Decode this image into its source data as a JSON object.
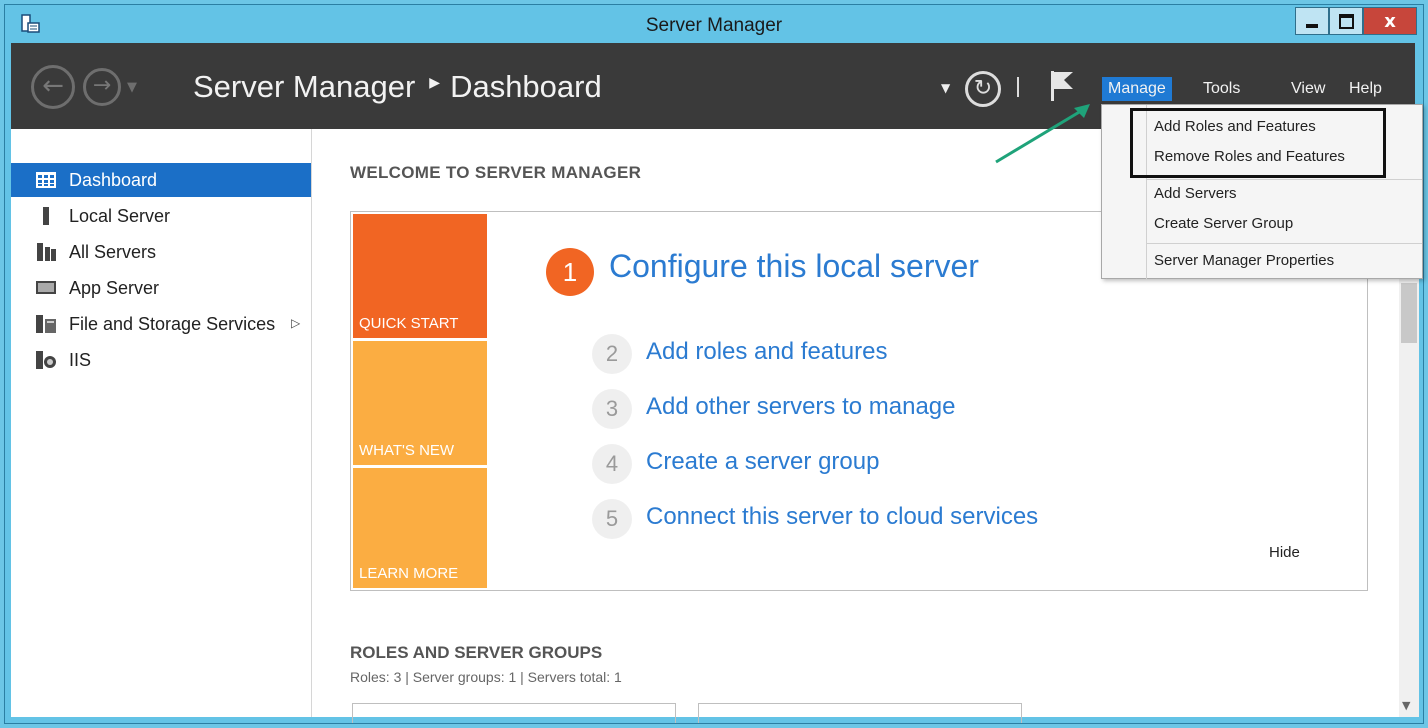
{
  "window": {
    "title": "Server Manager",
    "close_glyph": "x"
  },
  "header": {
    "breadcrumb_root": "Server Manager",
    "breadcrumb_current": "Dashboard",
    "menus": {
      "manage": "Manage",
      "tools": "Tools",
      "view": "View",
      "help": "Help"
    }
  },
  "sidebar": {
    "items": [
      {
        "label": "Dashboard",
        "icon": "dashboard-grid-icon",
        "active": true
      },
      {
        "label": "Local Server",
        "icon": "server-icon"
      },
      {
        "label": "All Servers",
        "icon": "servers-icon"
      },
      {
        "label": "App Server",
        "icon": "monitor-icon"
      },
      {
        "label": "File and Storage Services",
        "icon": "file-storage-icon"
      },
      {
        "label": "IIS",
        "icon": "iis-icon"
      }
    ]
  },
  "main": {
    "welcome_title": "WELCOME TO SERVER MANAGER",
    "tiles": {
      "quick_start": "QUICK START",
      "whats_new": "WHAT'S NEW",
      "learn_more": "LEARN MORE"
    },
    "step1": {
      "num": "1",
      "text": "Configure this local server"
    },
    "steps": [
      {
        "num": "2",
        "text": "Add roles and features"
      },
      {
        "num": "3",
        "text": "Add other servers to manage"
      },
      {
        "num": "4",
        "text": "Create a server group"
      },
      {
        "num": "5",
        "text": "Connect this server to cloud services"
      }
    ],
    "hide": "Hide",
    "roles_title": "ROLES AND SERVER GROUPS",
    "roles_stats": "Roles: 3   |   Server groups: 1   |   Servers total: 1"
  },
  "manage_menu": {
    "items": [
      "Add Roles and Features",
      "Remove Roles and Features",
      "Add Servers",
      "Create Server Group",
      "Server Manager Properties"
    ]
  },
  "colors": {
    "accent": "#1f7ad4",
    "orange": "#f16523",
    "amber": "#fbad42",
    "header": "#3a3a3a",
    "annotation_arrow": "#1fa37a"
  }
}
